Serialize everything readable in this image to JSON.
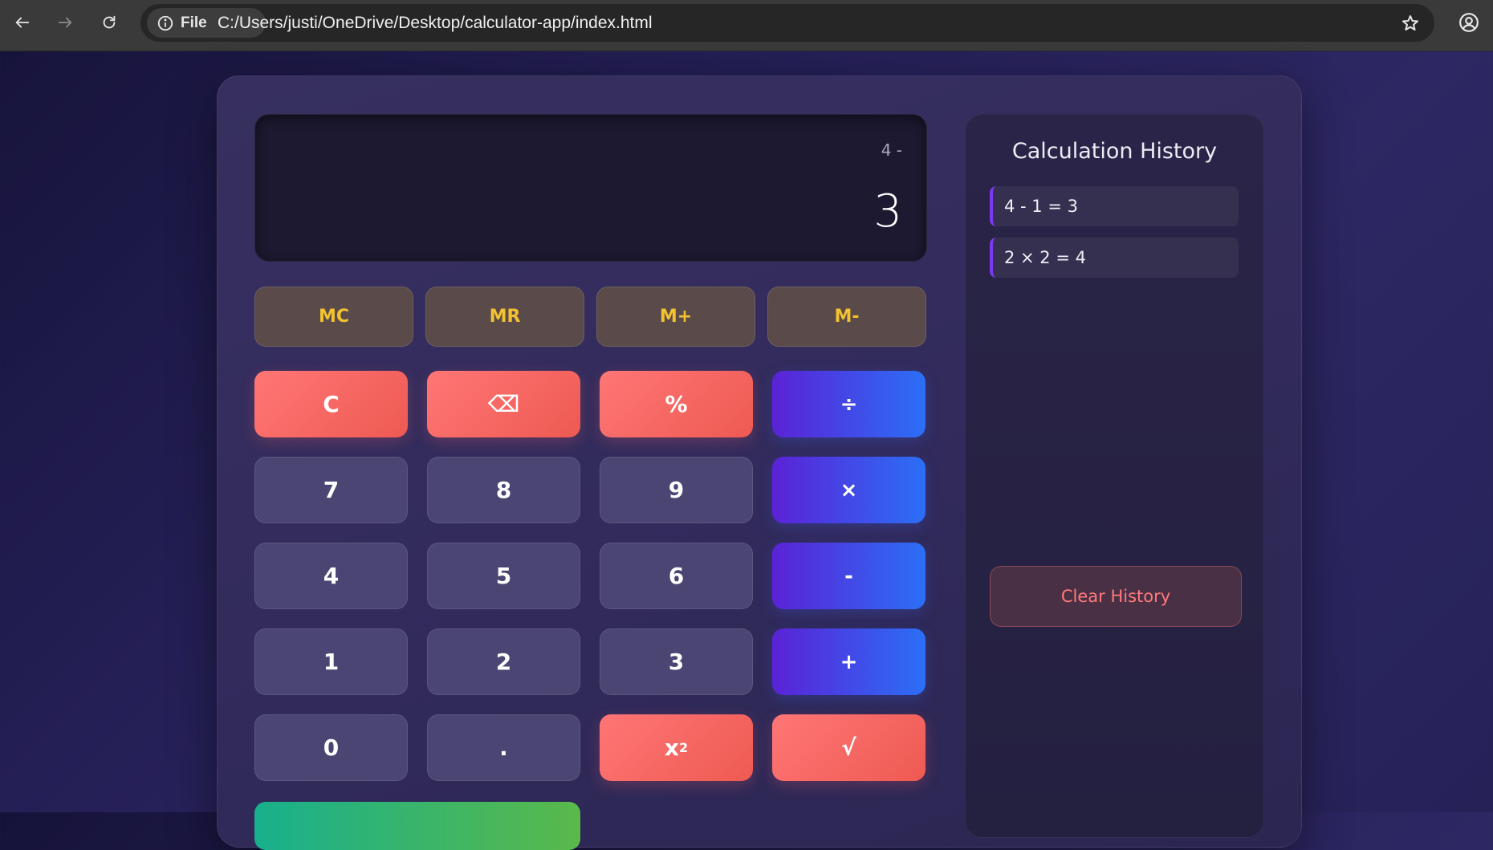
{
  "browser": {
    "scheme_label": "File",
    "url": "C:/Users/justi/OneDrive/Desktop/calculator-app/index.html"
  },
  "display": {
    "expression": "4 -",
    "result": "3"
  },
  "memory_buttons": [
    "MC",
    "MR",
    "M+",
    "M-"
  ],
  "keypad": {
    "clear": "C",
    "backspace": "⌫",
    "percent": "%",
    "divide": "÷",
    "seven": "7",
    "eight": "8",
    "nine": "9",
    "multiply": "×",
    "four": "4",
    "five": "5",
    "six": "6",
    "subtract": "-",
    "one": "1",
    "two": "2",
    "three": "3",
    "add": "+",
    "zero": "0",
    "decimal": ".",
    "square_base": "x",
    "square_exp": "2",
    "sqrt": "√"
  },
  "history": {
    "title": "Calculation History",
    "items": [
      "4 - 1 = 3",
      "2 × 2 = 4"
    ],
    "clear_label": "Clear History"
  },
  "colors": {
    "memory_text": "#f2c230",
    "red_button": "#ee5a52",
    "operator_gradient_start": "#5a22d6",
    "operator_gradient_end": "#2b6ff6",
    "equals_gradient_start": "#18b08d",
    "equals_gradient_end": "#5ab94a",
    "history_accent": "#7a3bf0"
  }
}
